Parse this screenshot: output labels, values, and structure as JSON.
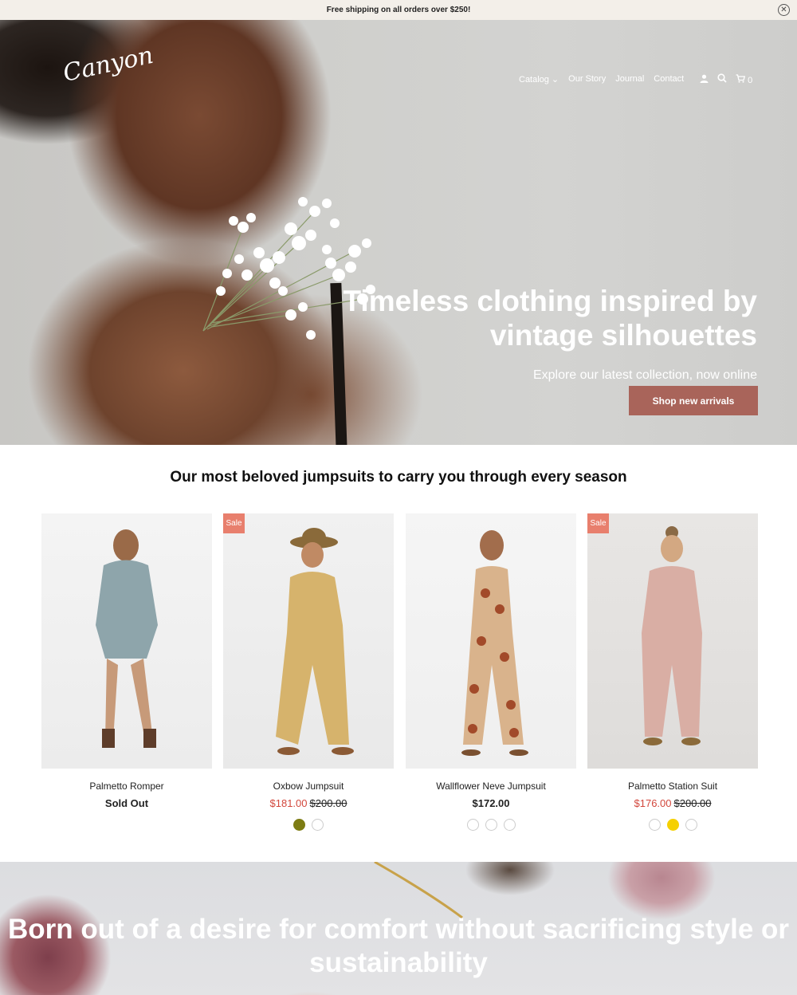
{
  "announcement": {
    "text": "Free shipping on all orders over $250!",
    "close_icon": "close-icon",
    "close_glyph": "✕"
  },
  "header": {
    "logo_text": "Canyon",
    "nav": [
      {
        "label": "Catalog",
        "has_dropdown": true
      },
      {
        "label": "Our Story"
      },
      {
        "label": "Journal"
      },
      {
        "label": "Contact"
      }
    ],
    "cart_count": "0"
  },
  "hero": {
    "title": "Timeless clothing inspired by vintage silhouettes",
    "subtitle": "Explore our latest collection, now online",
    "cta_label": "Shop new arrivals"
  },
  "collection": {
    "title": "Our most beloved jumpsuits to carry you through every season",
    "products": [
      {
        "name": "Palmetto Romper",
        "price": "Sold Out",
        "sale": false,
        "swatches": []
      },
      {
        "name": "Oxbow Jumpsuit",
        "price": "$181.00",
        "original_price": "$200.00",
        "sale": true,
        "badge": "Sale",
        "swatches": [
          "#7d7c13",
          "#ffffff"
        ]
      },
      {
        "name": "Wallflower Neve Jumpsuit",
        "price": "$172.00",
        "sale": false,
        "swatches": [
          "#ffffff",
          "#ffffff",
          "#ffffff"
        ]
      },
      {
        "name": "Palmetto Station Suit",
        "price": "$176.00",
        "original_price": "$200.00",
        "sale": true,
        "badge": "Sale",
        "swatches": [
          "#ffffff",
          "#f5d000",
          "#ffffff"
        ]
      }
    ]
  },
  "banner": {
    "title": "Born out of a desire for comfort without sacrificing style or sustainability"
  },
  "colors": {
    "accent_button": "#a9645a",
    "sale_badge": "#e87f6d",
    "sale_price": "#d2473c"
  }
}
